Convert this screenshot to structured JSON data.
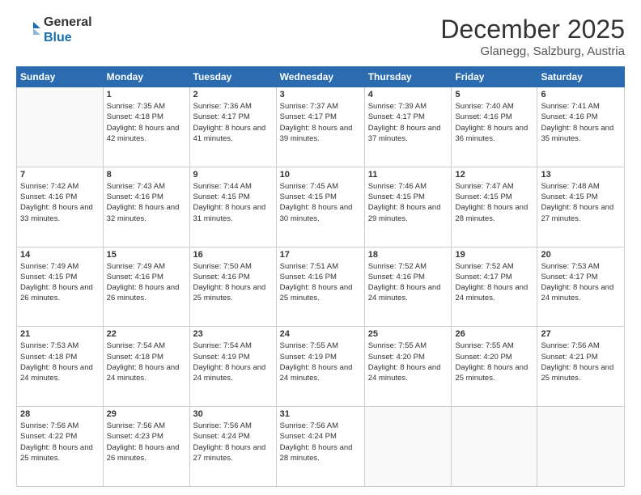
{
  "header": {
    "logo_line1": "General",
    "logo_line2": "Blue",
    "main_title": "December 2025",
    "subtitle": "Glanegg, Salzburg, Austria"
  },
  "days_of_week": [
    "Sunday",
    "Monday",
    "Tuesday",
    "Wednesday",
    "Thursday",
    "Friday",
    "Saturday"
  ],
  "weeks": [
    [
      {
        "day": "",
        "info": ""
      },
      {
        "day": "1",
        "info": "Sunrise: 7:35 AM\nSunset: 4:18 PM\nDaylight: 8 hours\nand 42 minutes."
      },
      {
        "day": "2",
        "info": "Sunrise: 7:36 AM\nSunset: 4:17 PM\nDaylight: 8 hours\nand 41 minutes."
      },
      {
        "day": "3",
        "info": "Sunrise: 7:37 AM\nSunset: 4:17 PM\nDaylight: 8 hours\nand 39 minutes."
      },
      {
        "day": "4",
        "info": "Sunrise: 7:39 AM\nSunset: 4:17 PM\nDaylight: 8 hours\nand 37 minutes."
      },
      {
        "day": "5",
        "info": "Sunrise: 7:40 AM\nSunset: 4:16 PM\nDaylight: 8 hours\nand 36 minutes."
      },
      {
        "day": "6",
        "info": "Sunrise: 7:41 AM\nSunset: 4:16 PM\nDaylight: 8 hours\nand 35 minutes."
      }
    ],
    [
      {
        "day": "7",
        "info": "Sunrise: 7:42 AM\nSunset: 4:16 PM\nDaylight: 8 hours\nand 33 minutes."
      },
      {
        "day": "8",
        "info": "Sunrise: 7:43 AM\nSunset: 4:16 PM\nDaylight: 8 hours\nand 32 minutes."
      },
      {
        "day": "9",
        "info": "Sunrise: 7:44 AM\nSunset: 4:15 PM\nDaylight: 8 hours\nand 31 minutes."
      },
      {
        "day": "10",
        "info": "Sunrise: 7:45 AM\nSunset: 4:15 PM\nDaylight: 8 hours\nand 30 minutes."
      },
      {
        "day": "11",
        "info": "Sunrise: 7:46 AM\nSunset: 4:15 PM\nDaylight: 8 hours\nand 29 minutes."
      },
      {
        "day": "12",
        "info": "Sunrise: 7:47 AM\nSunset: 4:15 PM\nDaylight: 8 hours\nand 28 minutes."
      },
      {
        "day": "13",
        "info": "Sunrise: 7:48 AM\nSunset: 4:15 PM\nDaylight: 8 hours\nand 27 minutes."
      }
    ],
    [
      {
        "day": "14",
        "info": "Sunrise: 7:49 AM\nSunset: 4:15 PM\nDaylight: 8 hours\nand 26 minutes."
      },
      {
        "day": "15",
        "info": "Sunrise: 7:49 AM\nSunset: 4:16 PM\nDaylight: 8 hours\nand 26 minutes."
      },
      {
        "day": "16",
        "info": "Sunrise: 7:50 AM\nSunset: 4:16 PM\nDaylight: 8 hours\nand 25 minutes."
      },
      {
        "day": "17",
        "info": "Sunrise: 7:51 AM\nSunset: 4:16 PM\nDaylight: 8 hours\nand 25 minutes."
      },
      {
        "day": "18",
        "info": "Sunrise: 7:52 AM\nSunset: 4:16 PM\nDaylight: 8 hours\nand 24 minutes."
      },
      {
        "day": "19",
        "info": "Sunrise: 7:52 AM\nSunset: 4:17 PM\nDaylight: 8 hours\nand 24 minutes."
      },
      {
        "day": "20",
        "info": "Sunrise: 7:53 AM\nSunset: 4:17 PM\nDaylight: 8 hours\nand 24 minutes."
      }
    ],
    [
      {
        "day": "21",
        "info": "Sunrise: 7:53 AM\nSunset: 4:18 PM\nDaylight: 8 hours\nand 24 minutes."
      },
      {
        "day": "22",
        "info": "Sunrise: 7:54 AM\nSunset: 4:18 PM\nDaylight: 8 hours\nand 24 minutes."
      },
      {
        "day": "23",
        "info": "Sunrise: 7:54 AM\nSunset: 4:19 PM\nDaylight: 8 hours\nand 24 minutes."
      },
      {
        "day": "24",
        "info": "Sunrise: 7:55 AM\nSunset: 4:19 PM\nDaylight: 8 hours\nand 24 minutes."
      },
      {
        "day": "25",
        "info": "Sunrise: 7:55 AM\nSunset: 4:20 PM\nDaylight: 8 hours\nand 24 minutes."
      },
      {
        "day": "26",
        "info": "Sunrise: 7:55 AM\nSunset: 4:20 PM\nDaylight: 8 hours\nand 25 minutes."
      },
      {
        "day": "27",
        "info": "Sunrise: 7:56 AM\nSunset: 4:21 PM\nDaylight: 8 hours\nand 25 minutes."
      }
    ],
    [
      {
        "day": "28",
        "info": "Sunrise: 7:56 AM\nSunset: 4:22 PM\nDaylight: 8 hours\nand 25 minutes."
      },
      {
        "day": "29",
        "info": "Sunrise: 7:56 AM\nSunset: 4:23 PM\nDaylight: 8 hours\nand 26 minutes."
      },
      {
        "day": "30",
        "info": "Sunrise: 7:56 AM\nSunset: 4:24 PM\nDaylight: 8 hours\nand 27 minutes."
      },
      {
        "day": "31",
        "info": "Sunrise: 7:56 AM\nSunset: 4:24 PM\nDaylight: 8 hours\nand 28 minutes."
      },
      {
        "day": "",
        "info": ""
      },
      {
        "day": "",
        "info": ""
      },
      {
        "day": "",
        "info": ""
      }
    ]
  ]
}
